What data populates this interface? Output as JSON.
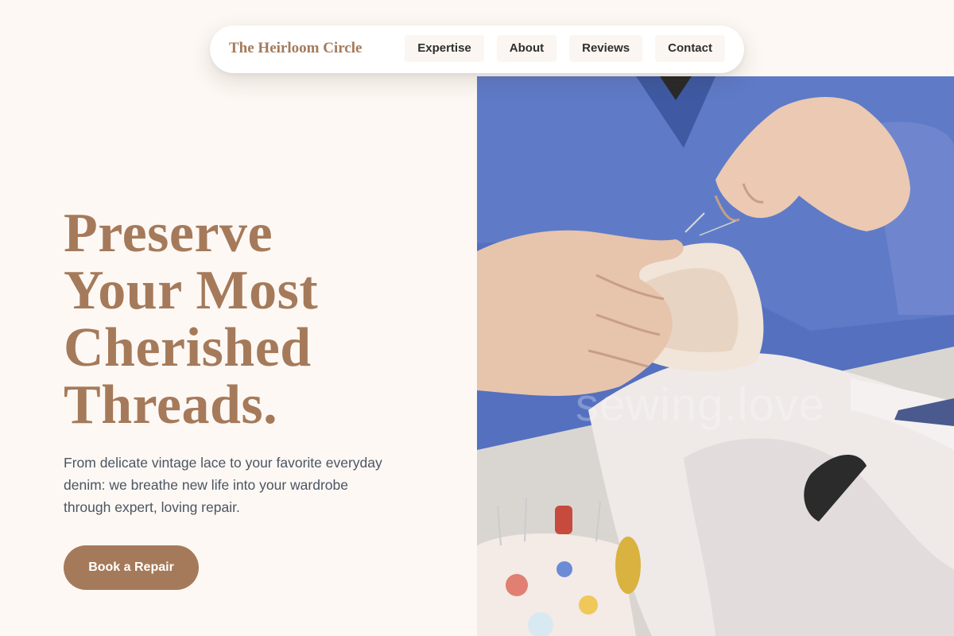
{
  "nav": {
    "brand": "The Heirloom Circle",
    "links": [
      {
        "label": "Expertise"
      },
      {
        "label": "About"
      },
      {
        "label": "Reviews"
      },
      {
        "label": "Contact"
      }
    ]
  },
  "hero": {
    "title": "Preserve\nYour Most\nCherished\nThreads.",
    "subtitle": "From delicate vintage lace to your favorite everyday denim: we breathe new life into your wardrobe through expert, loving repair.",
    "cta_label": "Book a Repair"
  },
  "photo": {
    "description_icon": "sewing-hands-photo",
    "watermark": "sewing.love"
  },
  "colors": {
    "background": "#fdf8f4",
    "accent": "#a57a5a",
    "text_muted": "#4b5563",
    "nav_pill": "#fbf6f1"
  }
}
